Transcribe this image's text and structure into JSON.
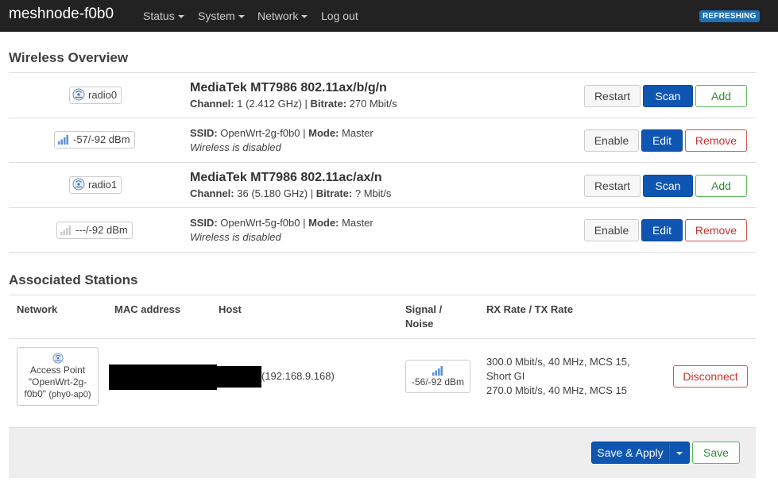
{
  "header": {
    "brand": "meshnode-f0b0",
    "nav": [
      {
        "label": "Status",
        "dropdown": true
      },
      {
        "label": "System",
        "dropdown": true
      },
      {
        "label": "Network",
        "dropdown": true
      },
      {
        "label": "Log out",
        "dropdown": false
      }
    ],
    "status_badge": "REFRESHING"
  },
  "wireless": {
    "title": "Wireless Overview",
    "radios": [
      {
        "badge": "radio0",
        "name": "MediaTek MT7986 802.11ax/b/g/n",
        "channel_label": "Channel:",
        "channel_value": "1 (2.412 GHz)",
        "bitrate_label": "Bitrate:",
        "bitrate_value": "270 Mbit/s",
        "buttons": {
          "restart": "Restart",
          "scan": "Scan",
          "add": "Add"
        },
        "network": {
          "signal_badge": "-57/-92 dBm",
          "ssid_label": "SSID:",
          "ssid_value": "OpenWrt-2g-f0b0",
          "mode_label": "Mode:",
          "mode_value": "Master",
          "state": "Wireless is disabled",
          "buttons": {
            "enable": "Enable",
            "edit": "Edit",
            "remove": "Remove"
          }
        }
      },
      {
        "badge": "radio1",
        "name": "MediaTek MT7986 802.11ac/ax/n",
        "channel_label": "Channel:",
        "channel_value": "36 (5.180 GHz)",
        "bitrate_label": "Bitrate:",
        "bitrate_value": "? Mbit/s",
        "buttons": {
          "restart": "Restart",
          "scan": "Scan",
          "add": "Add"
        },
        "network": {
          "signal_badge": "---/-92 dBm",
          "ssid_label": "SSID:",
          "ssid_value": "OpenWrt-5g-f0b0",
          "mode_label": "Mode:",
          "mode_value": "Master",
          "state": "Wireless is disabled",
          "buttons": {
            "enable": "Enable",
            "edit": "Edit",
            "remove": "Remove"
          }
        }
      }
    ]
  },
  "stations": {
    "title": "Associated Stations",
    "columns": [
      "Network",
      "MAC address",
      "Host",
      "Signal /",
      "Noise",
      "RX Rate / TX Rate"
    ],
    "row": {
      "network_line1": "Access Point",
      "network_line2": "\"OpenWrt-2g-",
      "network_line3": "f0b0\"",
      "network_iface": "(phy0-ap0)",
      "host_ip": "(192.168.9.168)",
      "signal": "-56/-92 dBm",
      "rx_rate": "300.0 Mbit/s, 40 MHz, MCS 15,",
      "rx_rate_2": "Short GI",
      "tx_rate": "270.0 Mbit/s, 40 MHz, MCS 15",
      "disconnect": "Disconnect"
    }
  },
  "footer": {
    "save_apply": "Save & Apply",
    "save": "Save"
  },
  "colors": {
    "topbar": "#222222",
    "primary": "#0f56b3",
    "add": "#5cb85c",
    "remove": "#d9534f"
  }
}
